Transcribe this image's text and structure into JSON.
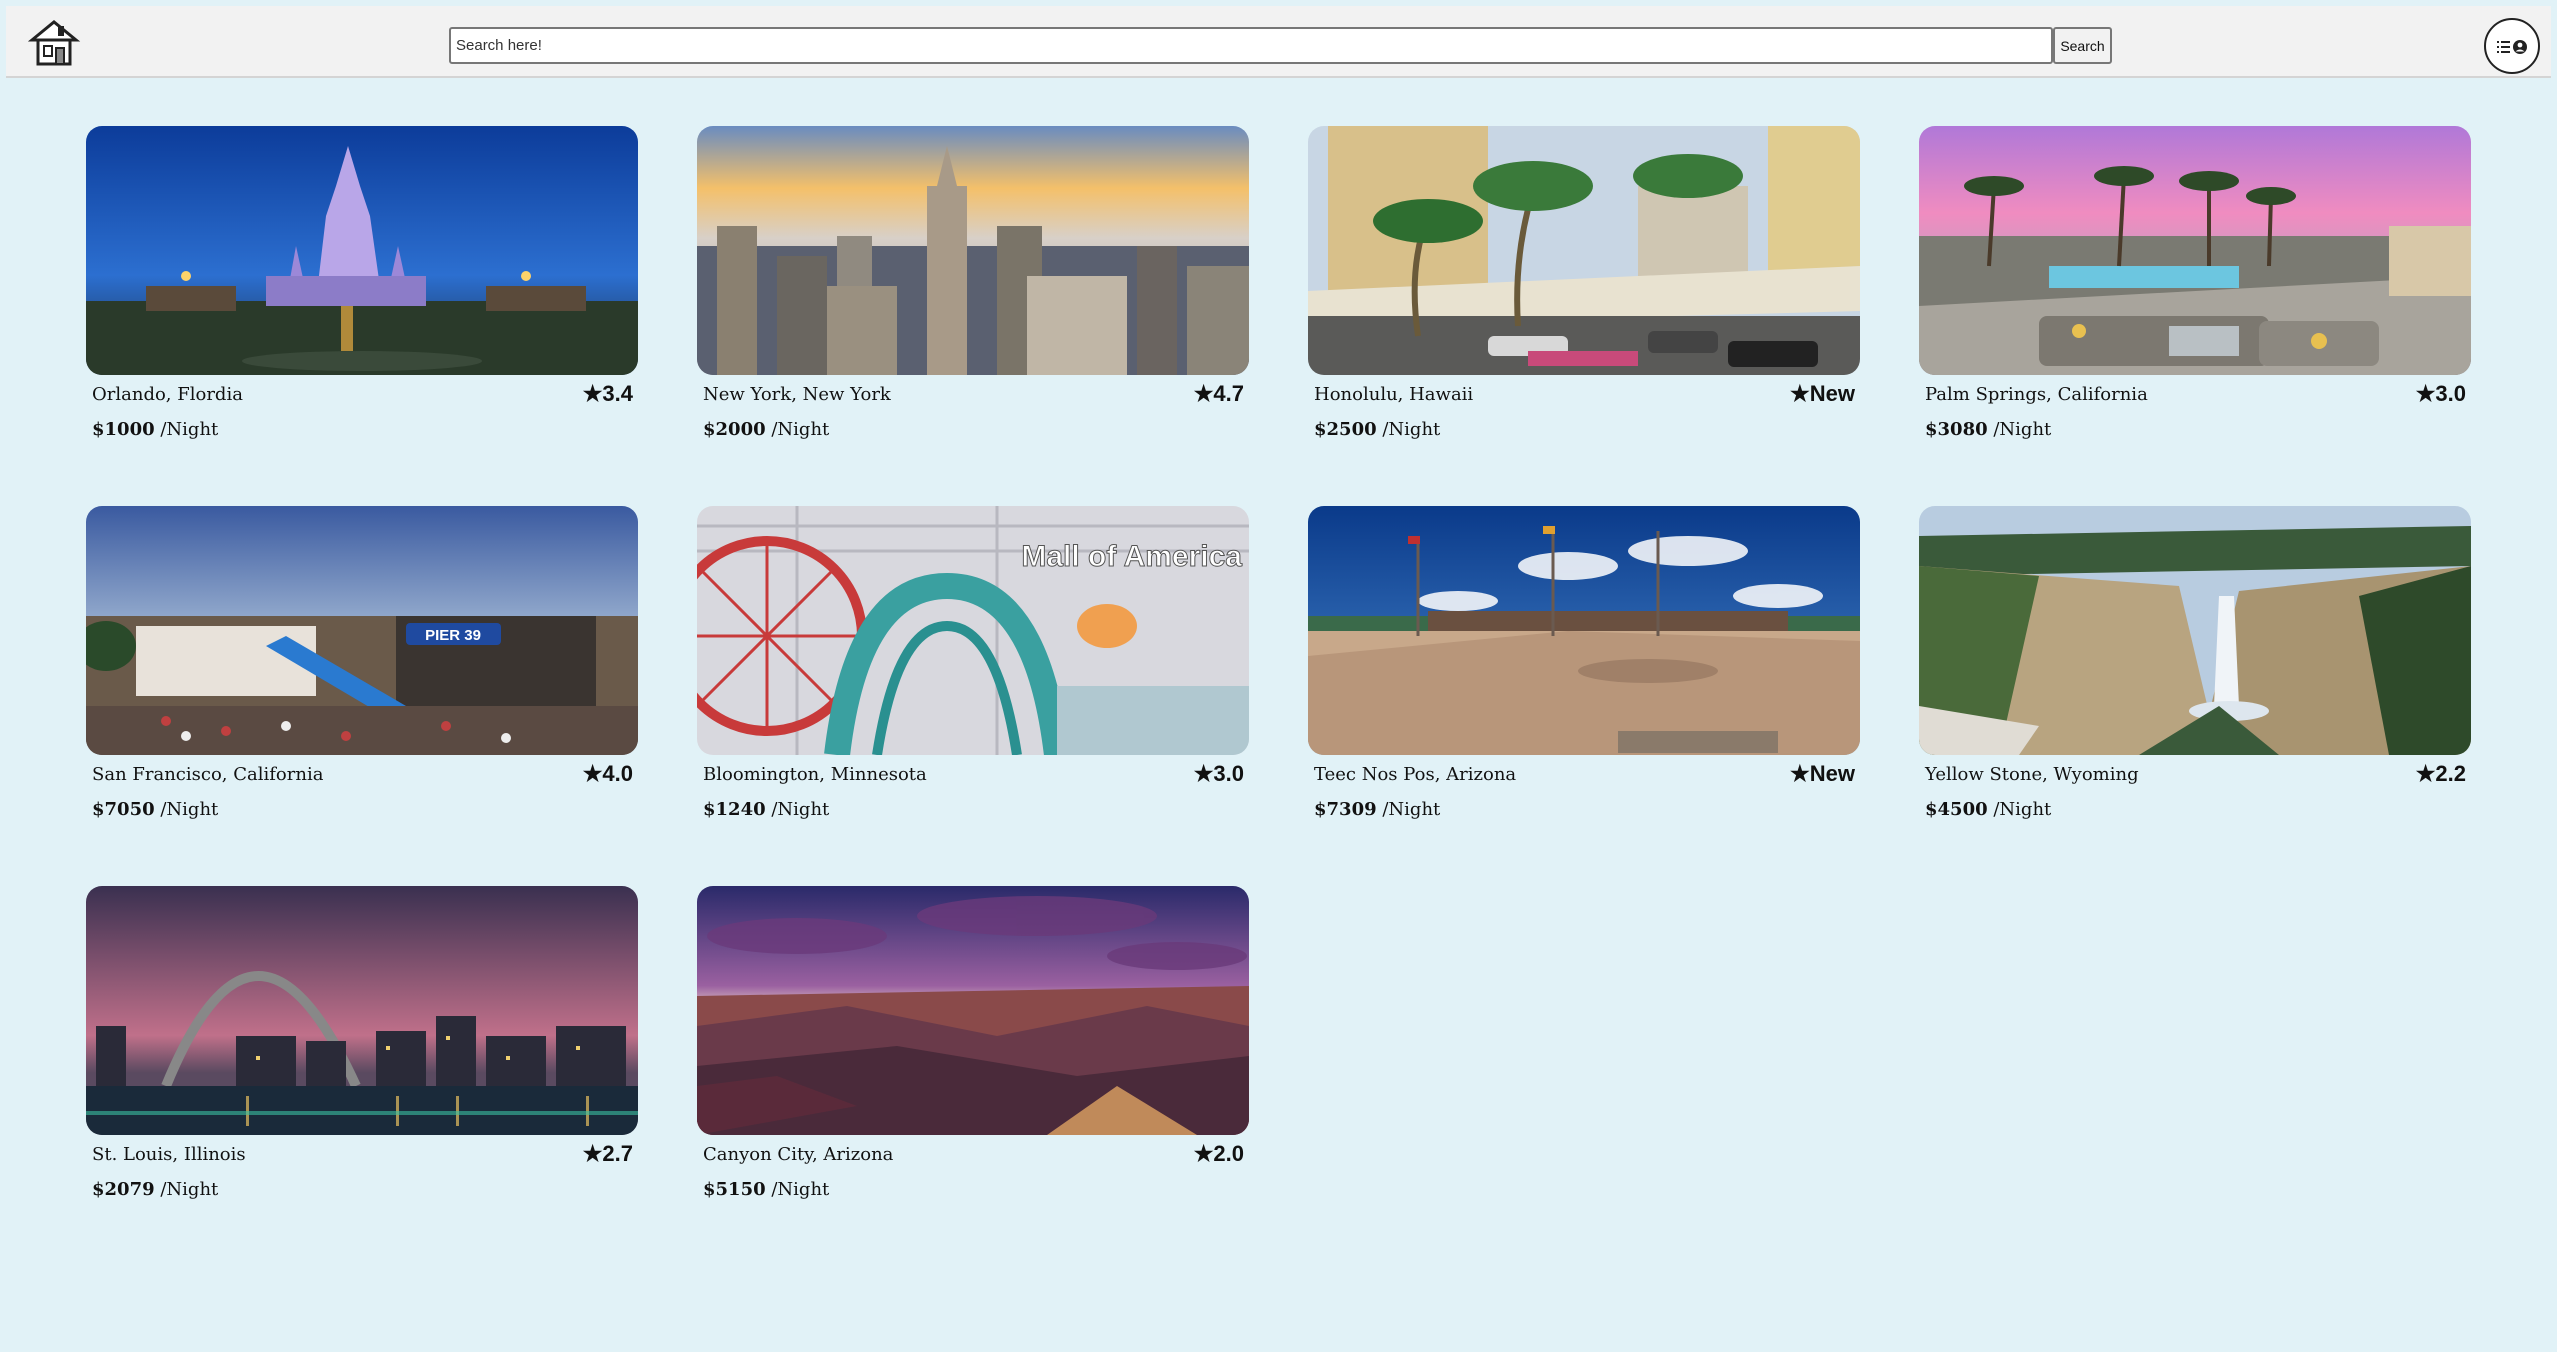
{
  "header": {
    "logo_icon": "house-logo-icon",
    "search_placeholder": "Search here!",
    "search_button": "Search",
    "menu_icon": "menu-user-icon"
  },
  "listings": [
    {
      "location": "Orlando, Flordia",
      "rating": "★3.4",
      "price": "$1000",
      "unit": " /Night",
      "image": "castle at night"
    },
    {
      "location": "New York, New York",
      "rating": "★4.7",
      "price": "$2000",
      "unit": " /Night",
      "image": "city skyline at sunset"
    },
    {
      "location": "Honolulu, Hawaii",
      "rating": "★New",
      "price": "$2500",
      "unit": " /Night",
      "image": "hotel with palm trees"
    },
    {
      "location": "Palm Springs, California",
      "rating": "★3.0",
      "price": "$3080",
      "unit": " /Night",
      "image": "pool patio at dusk"
    },
    {
      "location": "San Francisco, California",
      "rating": "★4.0",
      "price": "$7050",
      "unit": " /Night",
      "image": "pier with crowds"
    },
    {
      "location": "Bloomington, Minnesota",
      "rating": "★3.0",
      "price": "$1240",
      "unit": " /Night",
      "image": "indoor amusement park"
    },
    {
      "location": "Teec Nos Pos, Arizona",
      "rating": "★New",
      "price": "$7309",
      "unit": " /Night",
      "image": "plaza with flags"
    },
    {
      "location": "Yellow Stone, Wyoming",
      "rating": "★2.2",
      "price": "$4500",
      "unit": " /Night",
      "image": "canyon waterfall"
    },
    {
      "location": "St. Louis, Illinois",
      "rating": "★2.7",
      "price": "$2079",
      "unit": " /Night",
      "image": "arch skyline at dusk"
    },
    {
      "location": "Canyon City, Arizona",
      "rating": "★2.0",
      "price": "$5150",
      "unit": " /Night",
      "image": "grand canyon at dusk"
    }
  ],
  "image_text": {
    "mall_sign": "Mall of America",
    "pier_sign": "PIER 39"
  }
}
